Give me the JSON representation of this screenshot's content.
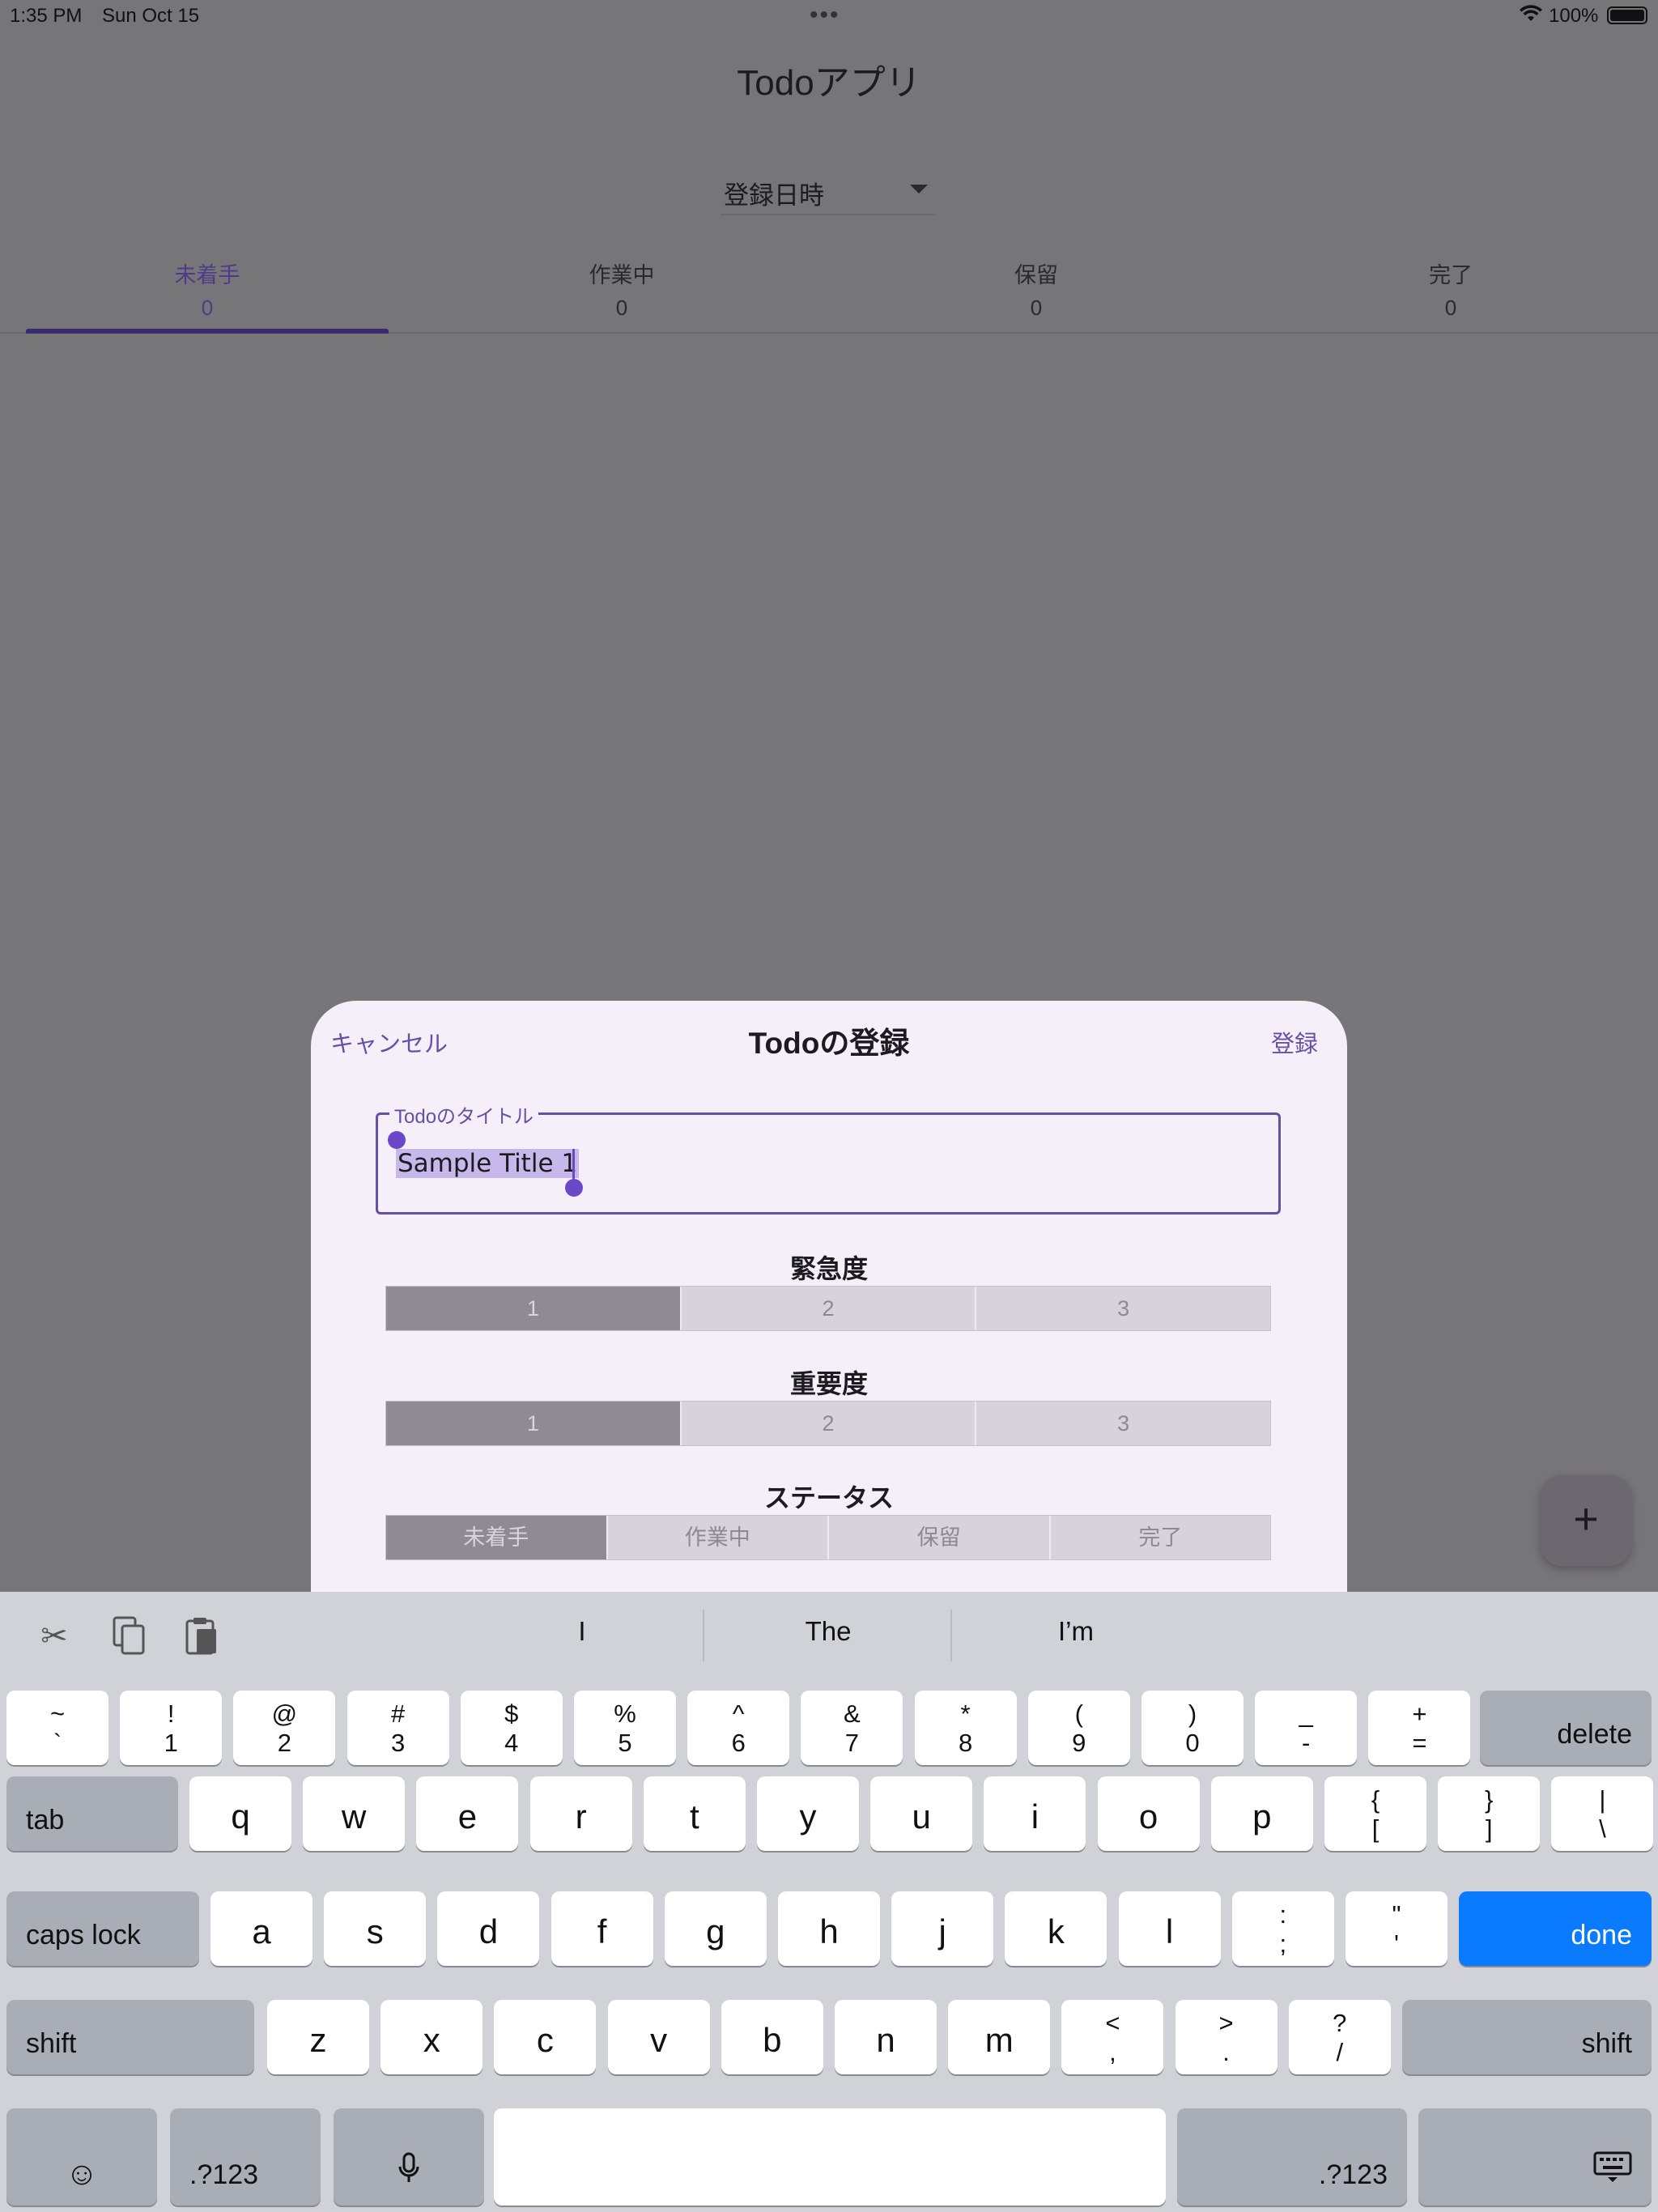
{
  "status_bar": {
    "time": "1:35 PM",
    "date": "Sun Oct 15",
    "battery": "100%"
  },
  "app": {
    "title": "Todoアプリ",
    "sort": {
      "selected": "登録日時"
    },
    "tabs": [
      {
        "label": "未着手",
        "count": "0"
      },
      {
        "label": "作業中",
        "count": "0"
      },
      {
        "label": "保留",
        "count": "0"
      },
      {
        "label": "完了",
        "count": "0"
      }
    ],
    "fab_label": "+"
  },
  "sheet": {
    "cancel": "キャンセル",
    "title": "Todoの登録",
    "submit": "登録",
    "title_field": {
      "label": "Todoのタイトル",
      "value": "Sample Title 1"
    },
    "urgency": {
      "label": "緊急度",
      "options": [
        "1",
        "2",
        "3"
      ],
      "selected": "1"
    },
    "importance": {
      "label": "重要度",
      "options": [
        "1",
        "2",
        "3"
      ],
      "selected": "1"
    },
    "status": {
      "label": "ステータス",
      "options": [
        "未着手",
        "作業中",
        "保留",
        "完了"
      ],
      "selected": "未着手"
    }
  },
  "keyboard": {
    "suggestions": [
      "I",
      "The",
      "I’m"
    ],
    "number_row": [
      {
        "top": "~",
        "bot": "`"
      },
      {
        "top": "!",
        "bot": "1"
      },
      {
        "top": "@",
        "bot": "2"
      },
      {
        "top": "#",
        "bot": "3"
      },
      {
        "top": "$",
        "bot": "4"
      },
      {
        "top": "%",
        "bot": "5"
      },
      {
        "top": "^",
        "bot": "6"
      },
      {
        "top": "&",
        "bot": "7"
      },
      {
        "top": "*",
        "bot": "8"
      },
      {
        "top": "(",
        "bot": "9"
      },
      {
        "top": ")",
        "bot": "0"
      },
      {
        "top": "_",
        "bot": "-"
      },
      {
        "top": "+",
        "bot": "="
      }
    ],
    "delete": "delete",
    "tab": "tab",
    "row_q": [
      "q",
      "w",
      "e",
      "r",
      "t",
      "y",
      "u",
      "i",
      "o",
      "p"
    ],
    "row_q_symbols": [
      {
        "top": "{",
        "bot": "["
      },
      {
        "top": "}",
        "bot": "]"
      },
      {
        "top": "|",
        "bot": "\\"
      }
    ],
    "caps_lock": "caps lock",
    "row_a": [
      "a",
      "s",
      "d",
      "f",
      "g",
      "h",
      "j",
      "k",
      "l"
    ],
    "row_a_symbols": [
      {
        "top": ":",
        "bot": ";"
      },
      {
        "top": "\"",
        "bot": "'"
      }
    ],
    "done": "done",
    "shift": "shift",
    "row_z": [
      "z",
      "x",
      "c",
      "v",
      "b",
      "n",
      "m"
    ],
    "row_z_symbols": [
      {
        "top": "<",
        "bot": ","
      },
      {
        "top": ">",
        "bot": "."
      },
      {
        "top": "?",
        "bot": "/"
      }
    ],
    "numbers_toggle": ".?123"
  }
}
